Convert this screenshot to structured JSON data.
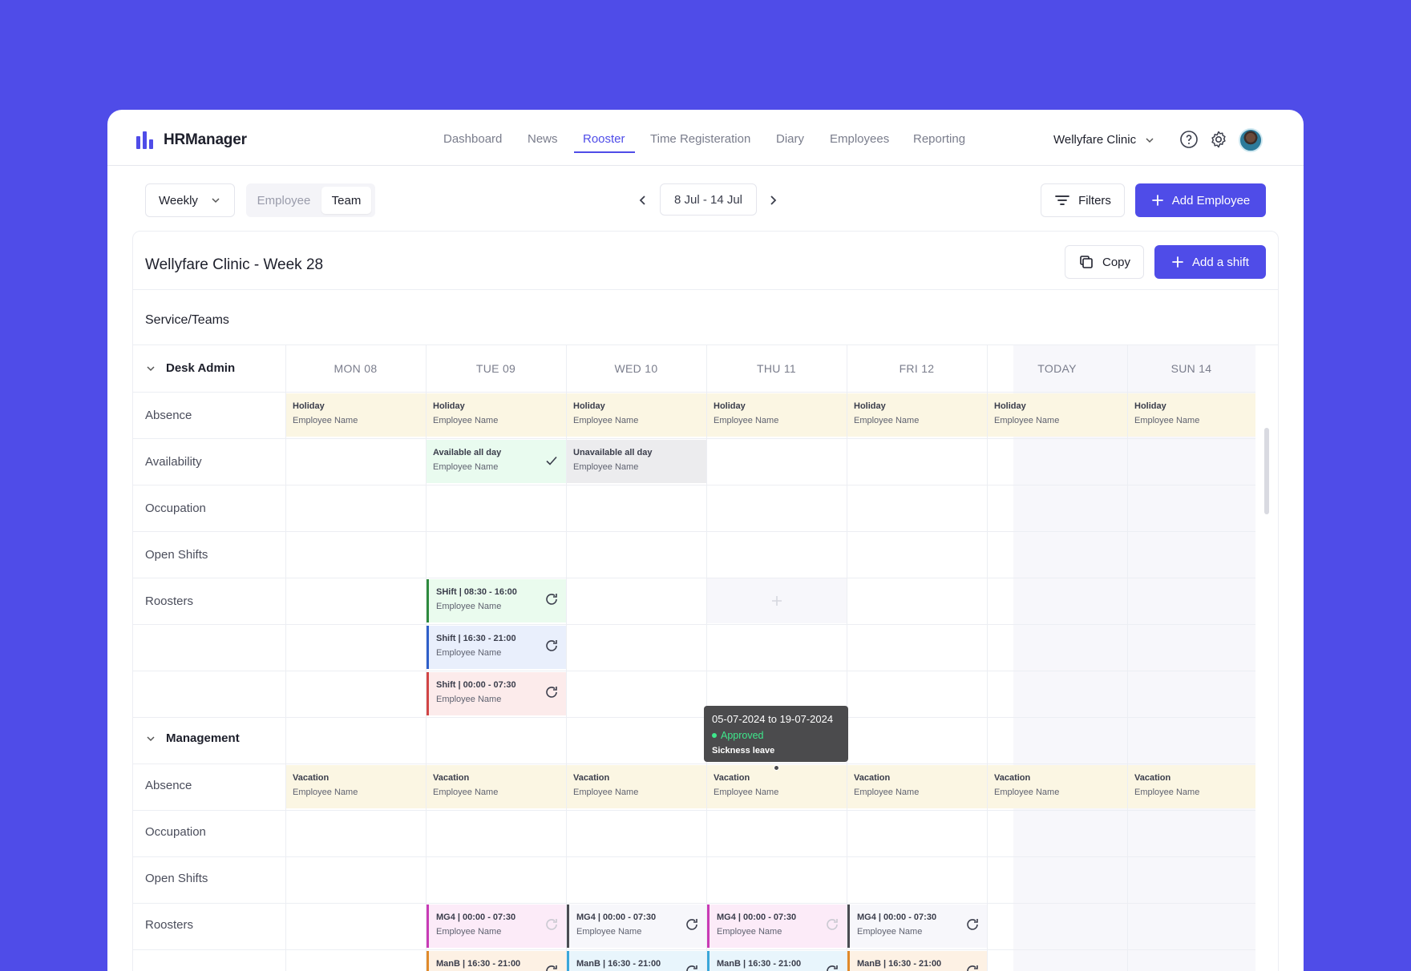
{
  "brand": {
    "name": "HRManager",
    "color": "#4f4ce8"
  },
  "nav": {
    "items": [
      {
        "label": "Dashboard",
        "active": false
      },
      {
        "label": "News",
        "active": false
      },
      {
        "label": "Rooster",
        "active": true
      },
      {
        "label": "Time Registeration",
        "active": false
      },
      {
        "label": "Diary",
        "active": false
      },
      {
        "label": "Employees",
        "active": false
      },
      {
        "label": "Reporting",
        "active": false
      }
    ],
    "clinic": "Wellyfare Clinic",
    "icons": [
      "help-icon",
      "settings-icon",
      "avatar"
    ]
  },
  "toolbar": {
    "view_select": "Weekly",
    "segment": {
      "left": "Employee",
      "right": "Team",
      "selected": "Team"
    },
    "date_range": "8 Jul - 14 Jul",
    "filters_label": "Filters",
    "add_employee_label": "Add Employee"
  },
  "card": {
    "title": "Wellyfare Clinic - Week 28",
    "copy_label": "Copy",
    "add_shift_label": "Add a shift",
    "section_title": "Service/Teams"
  },
  "days": [
    "MON 08",
    "TUE 09",
    "WED 10",
    "THU 11",
    "FRI 12",
    "TODAY",
    "SUN 14"
  ],
  "groups": [
    {
      "name": "Desk Admin",
      "rows": [
        "Absence",
        "Availability",
        "Occupation",
        "Open Shifts",
        "Roosters"
      ],
      "absence": {
        "title": "Holiday",
        "employee": "Employee Name"
      },
      "availability": [
        {
          "title": "Available all day",
          "employee": "Employee Name"
        },
        {
          "title": "Unavailable all day",
          "employee": "Employee Name"
        }
      ],
      "shifts": [
        {
          "title": "SHift | 08:30 - 16:00",
          "employee": "Employee Name",
          "color": "#2e8a3e",
          "bg": "#eafbee"
        },
        {
          "title": "Shift | 16:30 - 21:00",
          "employee": "Employee Name",
          "color": "#2f5fc9",
          "bg": "#e9effc"
        },
        {
          "title": "Shift | 00:00 - 07:30",
          "employee": "Employee Name",
          "color": "#d14545",
          "bg": "#fcebeb"
        }
      ]
    },
    {
      "name": "Management",
      "rows": [
        "Absence",
        "Occupation",
        "Open Shifts",
        "Roosters"
      ],
      "absence": {
        "title": "Vacation",
        "employee": "Employee Name"
      },
      "shifts_row1": {
        "title": "MG4 | 00:00 - 07:30",
        "employee": "Employee Name"
      },
      "shifts_row2": {
        "title": "ManB | 16:30 - 21:00"
      }
    }
  ],
  "tooltip": {
    "dates": "05-07-2024 to 19-07-2024",
    "status": "Approved",
    "kind": "Sickness leave"
  }
}
